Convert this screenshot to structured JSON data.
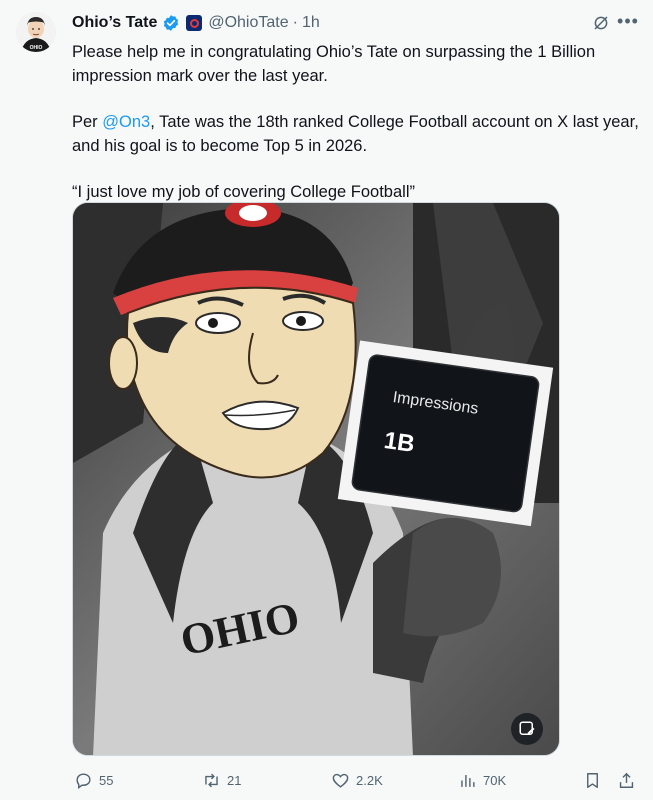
{
  "author": {
    "display_name": "Ohio’s Tate",
    "handle": "@OhioTate",
    "separator": "·",
    "time": "1h",
    "avatar_shirt_text": "OHIO"
  },
  "post": {
    "paragraph1": "Please help me in congratulating Ohio’s Tate on surpassing the 1 Billion impression mark over the last year.",
    "paragraph2_prefix": "Per ",
    "paragraph2_mention": "@On3",
    "paragraph2_suffix": ", Tate was the 18th ranked College Football account on X last year, and his goal is to become Top 5 in 2026.",
    "paragraph3": "“I just love my job of covering College Football”"
  },
  "media": {
    "card_label": "Impressions",
    "card_value": "1B",
    "jersey_text": "OHIO"
  },
  "actions": {
    "replies": "55",
    "reposts": "21",
    "likes": "2.2K",
    "views": "70K"
  },
  "colors": {
    "accent": "#1d9bf0",
    "secondary_text": "#536471",
    "background": "#f7f9f9"
  }
}
